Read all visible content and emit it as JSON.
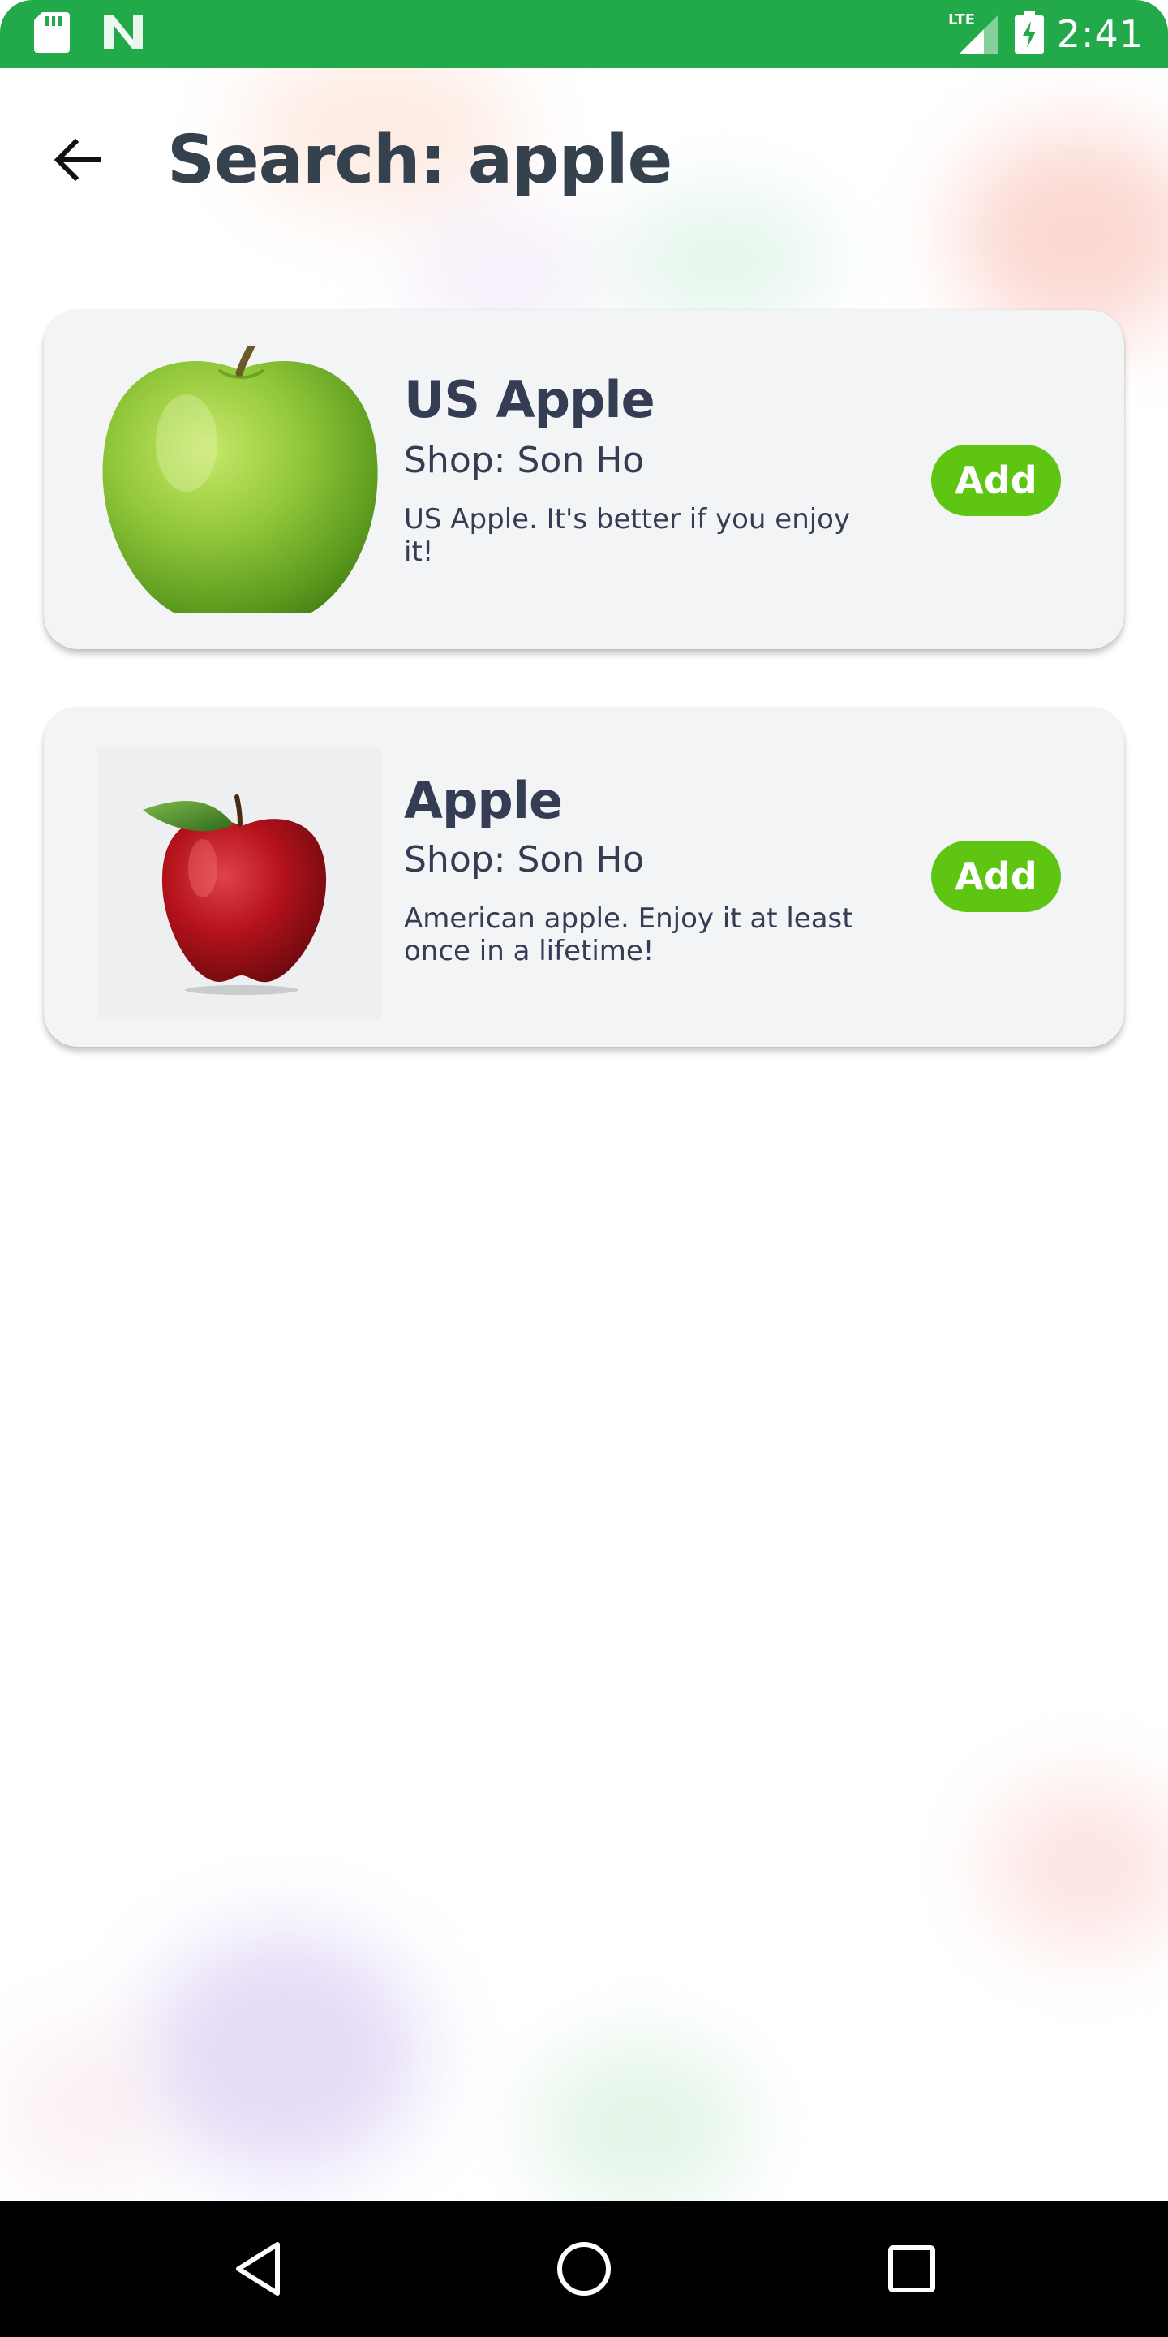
{
  "status_bar": {
    "time": "2:41",
    "network": "LTE",
    "background_color": "#22a94a",
    "icons": [
      "sd-card-icon",
      "n-notification-icon",
      "lte-signal-icon",
      "battery-charging-icon"
    ]
  },
  "header": {
    "title": "Search: apple",
    "back_icon": "arrow-left-icon"
  },
  "products": [
    {
      "name": "US Apple",
      "shop": "Shop: Son Ho",
      "description": "US Apple. It's better if you enjoy it!",
      "image": "green-apple-image",
      "add_label": "Add"
    },
    {
      "name": "Apple",
      "shop": "Shop: Son Ho",
      "description": "American apple. Enjoy it at least once in a lifetime!",
      "image": "red-apple-image",
      "add_label": "Add"
    }
  ],
  "nav_bar": {
    "buttons": [
      "back-triangle-icon",
      "home-circle-icon",
      "recents-square-icon"
    ]
  },
  "colors": {
    "accent_green": "#5ec613",
    "status_green": "#22a94a",
    "text_dark": "#353d55",
    "card_bg": "#f3f4f6"
  }
}
